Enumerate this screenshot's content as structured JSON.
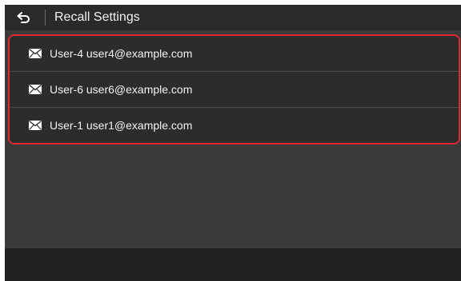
{
  "header": {
    "title": "Recall Settings",
    "back_icon": "back-arrow-icon"
  },
  "list": {
    "items": [
      {
        "label": "User-4 user4@example.com",
        "icon": "mail-icon"
      },
      {
        "label": "User-6 user6@example.com",
        "icon": "mail-icon"
      },
      {
        "label": "User-1 user1@example.com",
        "icon": "mail-icon"
      }
    ]
  },
  "colors": {
    "accent": "#e0282f",
    "background": "#3b3b3b",
    "row": "#2c2c2c",
    "text": "#f2f2f2"
  }
}
